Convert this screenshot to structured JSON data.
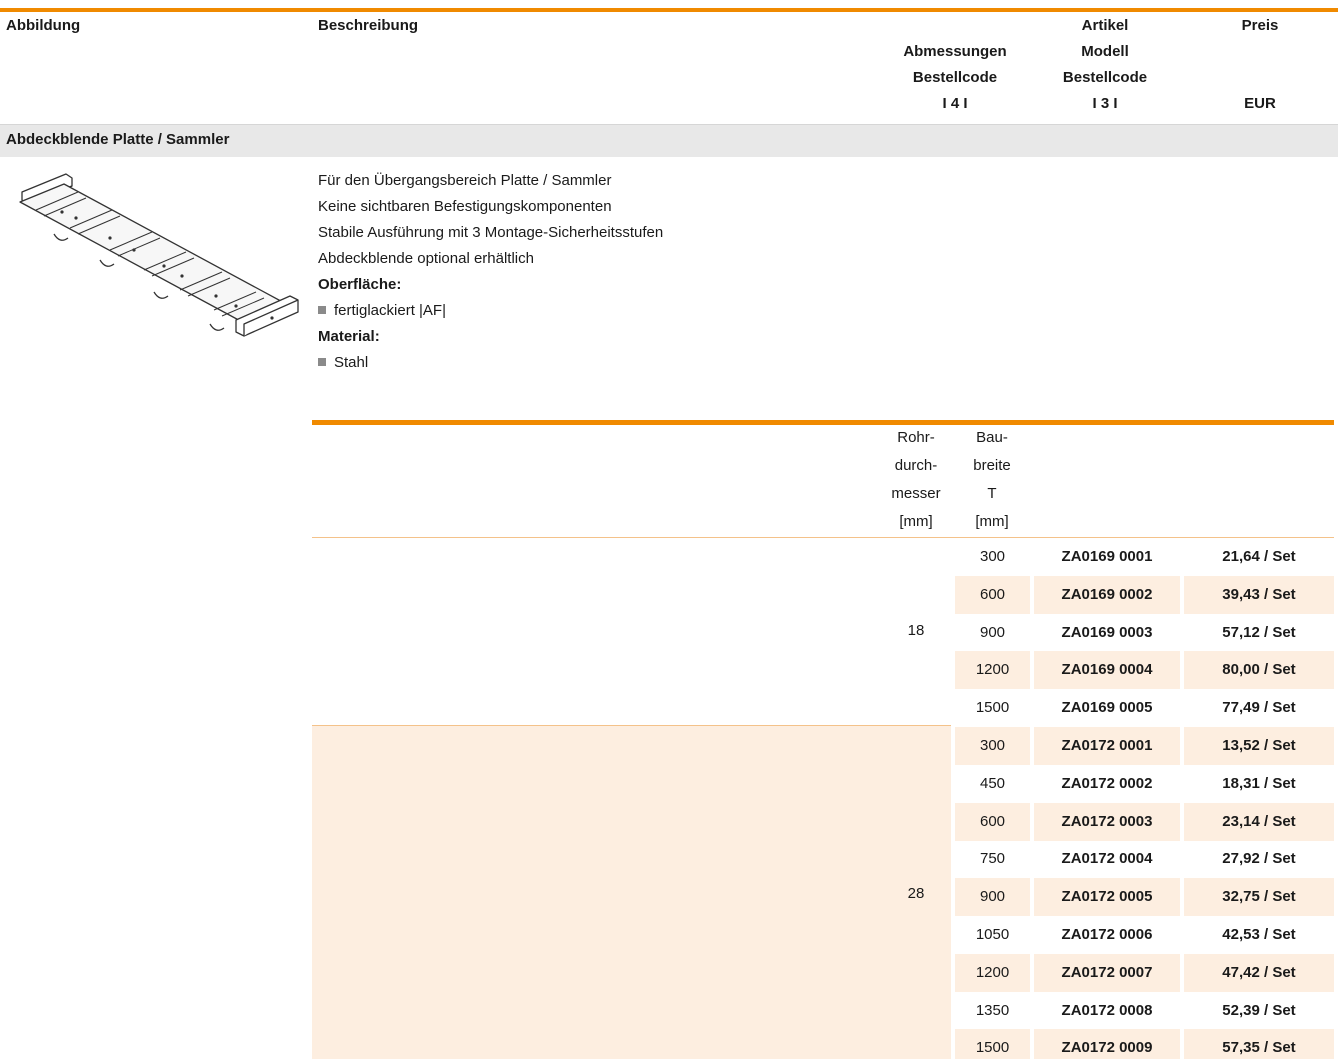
{
  "header": {
    "abbildung": "Abbildung",
    "beschreibung": "Beschreibung",
    "abmessungen": [
      "Abmessungen",
      "Bestellcode",
      "I 4 I"
    ],
    "artikel": [
      "Artikel",
      "Modell",
      "Bestellcode",
      "I 3 I"
    ],
    "preis": "Preis",
    "eur": "EUR"
  },
  "section": {
    "title": "Abdeckblende Platte / Sammler"
  },
  "description": {
    "lines": [
      "Für den Übergangsbereich Platte / Sammler",
      "Keine sichtbaren Befestigungskomponenten",
      "Stabile Ausführung mit 3 Montage-Sicherheitsstufen",
      "Abdeckblende optional erhältlich"
    ],
    "oberflaeche_label": "Oberfläche:",
    "oberflaeche_value": "fertiglackiert |AF|",
    "material_label": "Material:",
    "material_value": "Stahl"
  },
  "table": {
    "col_rohr": [
      "Rohr-",
      "durch-",
      "messer",
      "[mm]"
    ],
    "col_bau": [
      "Bau-",
      "breite",
      "T",
      "[mm]"
    ],
    "groups": [
      {
        "diameter": "18",
        "rows": [
          {
            "width": "300",
            "code": "ZA0169 0001",
            "price": "21,64 / Set"
          },
          {
            "width": "600",
            "code": "ZA0169 0002",
            "price": "39,43 / Set"
          },
          {
            "width": "900",
            "code": "ZA0169 0003",
            "price": "57,12 / Set"
          },
          {
            "width": "1200",
            "code": "ZA0169 0004",
            "price": "80,00 / Set"
          },
          {
            "width": "1500",
            "code": "ZA0169 0005",
            "price": "77,49 / Set"
          }
        ]
      },
      {
        "diameter": "28",
        "rows": [
          {
            "width": "300",
            "code": "ZA0172 0001",
            "price": "13,52 / Set"
          },
          {
            "width": "450",
            "code": "ZA0172 0002",
            "price": "18,31 / Set"
          },
          {
            "width": "600",
            "code": "ZA0172 0003",
            "price": "23,14 / Set"
          },
          {
            "width": "750",
            "code": "ZA0172 0004",
            "price": "27,92 / Set"
          },
          {
            "width": "900",
            "code": "ZA0172 0005",
            "price": "32,75 / Set"
          },
          {
            "width": "1050",
            "code": "ZA0172 0006",
            "price": "42,53 / Set"
          },
          {
            "width": "1200",
            "code": "ZA0172 0007",
            "price": "47,42 / Set"
          },
          {
            "width": "1350",
            "code": "ZA0172 0008",
            "price": "52,39 / Set"
          },
          {
            "width": "1500",
            "code": "ZA0172 0009",
            "price": "57,35 / Set"
          }
        ]
      }
    ]
  },
  "colors": {
    "accent": "#f08a00",
    "row_shade": "#fdeee0",
    "section_bg": "#e8e8e8"
  }
}
